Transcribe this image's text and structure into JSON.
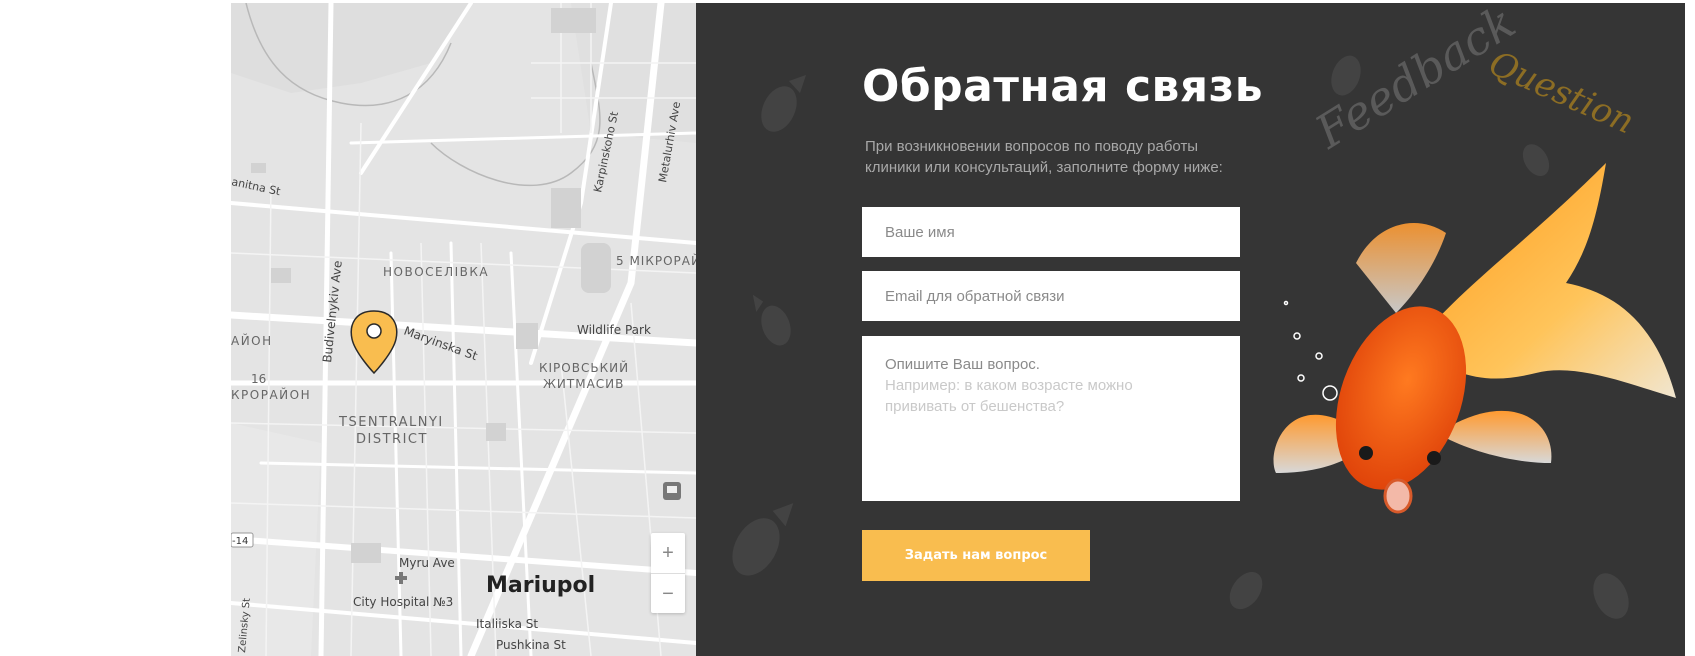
{
  "map": {
    "labels": {
      "novoselivka": "НОВОСЕЛІВКА",
      "mikroraion5": "5 МІКРОРАЙ",
      "wildlife_park": "Wildlife Park",
      "kirovskyi1": "КІРОВСЬКИЙ",
      "kirovskyi2": "ЖИТМАСИВ",
      "tsentralnyi1": "TSENTRALNYI",
      "tsentralnyi2": "DISTRICT",
      "mariupol": "Mariupol",
      "myru_ave": "Myru Ave",
      "city_hospital": "City Hospital №3",
      "italiiska": "Italiiska St",
      "pushkina": "Pushkina St",
      "maryinska": "Maryinska St",
      "budivelnykiv": "Budivelnykiv Ave",
      "karpinskoho": "Karpinskoho St",
      "metalurhiv": "Metalurhiv Ave",
      "granitna": "anitna St",
      "zelinsky": "Zelinsky St",
      "raion_left": "АЙОН",
      "num16": "16",
      "mikroraion_left": "КРОРАЙОН",
      "road14": "-14"
    },
    "zoom_in": "+",
    "zoom_out": "−"
  },
  "feedback": {
    "title": "Обратная связь",
    "description": "При возникновении вопросов по поводу работы клиники или консультаций, заполните форму ниже:",
    "name_placeholder": "Ваше имя",
    "email_placeholder": "Email для обратной связи",
    "question_placeholder_line1": "Опишите Ваш вопрос.",
    "question_placeholder_line2": "Например: в каком возрасте можно прививать от бешенства?",
    "submit_label": "Задать нам вопрос",
    "decor_feedback": "Feedback",
    "decor_question": "Question"
  },
  "colors": {
    "accent": "#f9bd4f",
    "panel_bg": "#353535",
    "map_bg": "#e4e4e4"
  }
}
